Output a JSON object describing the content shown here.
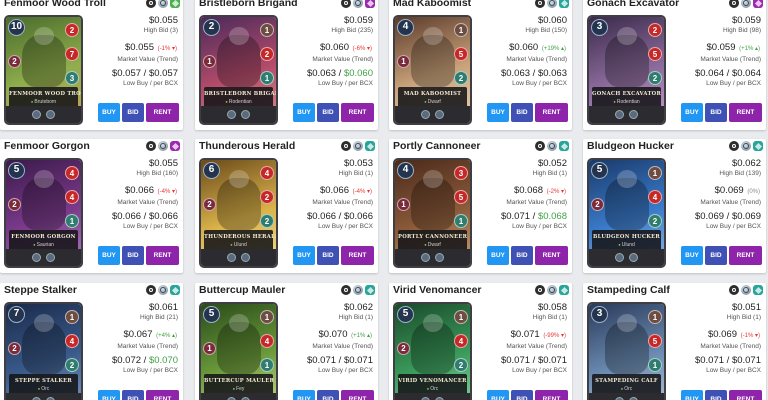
{
  "labels": {
    "high_bid": "High Bid",
    "market_value": "Market Value (Trend)",
    "low_buy": "Low Buy / per BCX",
    "buy": "BUY",
    "bid": "BID",
    "rent": "RENT",
    "separator": " / "
  },
  "cards": [
    {
      "name": "Fenmoor Wood Troll",
      "price": "$0.055",
      "bid_count": "(3)",
      "market": "$0.055",
      "change": "(-1% ▾)",
      "change_dir": "neg",
      "low_a": "$0.057",
      "low_b": "$0.057",
      "low_b_green": false,
      "mana": "10",
      "race": "Brutebom",
      "gem3": "gem-green",
      "stats": [
        "2",
        "7",
        "3"
      ],
      "left_stat": "2",
      "colors": [
        "#4a6b2c",
        "#8fae4c",
        "#c4a35a"
      ],
      "stat_colors": [
        "#c62828",
        "#c62828",
        "#2e7d6e"
      ]
    },
    {
      "name": "Bristleborn Brigand",
      "price": "$0.059",
      "bid_count": "(235)",
      "market": "$0.060",
      "change": "(-6% ▾)",
      "change_dir": "neg",
      "low_a": "$0.063",
      "low_b": "$0.060",
      "low_b_green": true,
      "mana": "2",
      "race": "Rodentian",
      "gem3": "gem-purple",
      "stats": [
        "1",
        "2",
        "1"
      ],
      "left_stat": "1",
      "colors": [
        "#4a2a5a",
        "#b34b6a",
        "#d98a8a"
      ],
      "stat_colors": [
        "#6d4c41",
        "#c62828",
        "#2e7d6e"
      ]
    },
    {
      "name": "Mad Kaboomist",
      "price": "$0.060",
      "bid_count": "(150)",
      "market": "$0.060",
      "change": "(+19% ▴)",
      "change_dir": "pos",
      "low_a": "$0.063",
      "low_b": "$0.063",
      "low_b_green": false,
      "mana": "4",
      "race": "Dwarf",
      "gem3": "gem-teal",
      "stats": [
        "1",
        "5",
        "2"
      ],
      "left_stat": "1",
      "colors": [
        "#5a3a2a",
        "#c9a27a",
        "#e8d3b0"
      ],
      "stat_colors": [
        "#6d4c41",
        "#c62828",
        "#2e7d6e"
      ]
    },
    {
      "name": "Gonach Excavator",
      "price": "$0.059",
      "bid_count": "(98)",
      "market": "$0.059",
      "change": "(+1% ▴)",
      "change_dir": "pos",
      "low_a": "$0.064",
      "low_b": "$0.064",
      "low_b_green": false,
      "mana": "3",
      "race": "Rodentian",
      "gem3": "gem-purple",
      "stats": [
        "2",
        "5",
        "2"
      ],
      "left_stat": "",
      "colors": [
        "#3a2a4a",
        "#8a6a9a",
        "#c59ad0"
      ],
      "stat_colors": [
        "#c62828",
        "#c62828",
        "#2e7d6e"
      ]
    },
    {
      "name": "Fenmoor Gorgon",
      "price": "$0.055",
      "bid_count": "(160)",
      "market": "$0.066",
      "change": "(-4% ▾)",
      "change_dir": "neg",
      "low_a": "$0.066",
      "low_b": "$0.066",
      "low_b_green": false,
      "mana": "5",
      "race": "Saurian",
      "gem3": "gem-purple",
      "stats": [
        "4",
        "4",
        "1"
      ],
      "left_stat": "2",
      "colors": [
        "#3a1a4a",
        "#7a3a8a",
        "#b07ac0"
      ],
      "stat_colors": [
        "#c62828",
        "#c62828",
        "#2e7d6e"
      ]
    },
    {
      "name": "Thunderous Herald",
      "price": "$0.053",
      "bid_count": "(1)",
      "market": "$0.066",
      "change": "(-4% ▾)",
      "change_dir": "neg",
      "low_a": "$0.066",
      "low_b": "$0.066",
      "low_b_green": false,
      "mana": "6",
      "race": "Ulund",
      "gem3": "gem-teal",
      "stats": [
        "4",
        "2",
        "2"
      ],
      "left_stat": "2",
      "colors": [
        "#6a4a1a",
        "#d9b24a",
        "#f2dc8a"
      ],
      "stat_colors": [
        "#c62828",
        "#c62828",
        "#2e7d6e"
      ]
    },
    {
      "name": "Portly Cannoneer",
      "price": "$0.052",
      "bid_count": "(1)",
      "market": "$0.068",
      "change": "(-2% ▾)",
      "change_dir": "neg",
      "low_a": "$0.071",
      "low_b": "$0.068",
      "low_b_green": true,
      "mana": "4",
      "race": "Dwarf",
      "gem3": "gem-teal",
      "stats": [
        "3",
        "5",
        "1"
      ],
      "left_stat": "1",
      "colors": [
        "#4a2a1a",
        "#8a5a3a",
        "#c9a070"
      ],
      "stat_colors": [
        "#c62828",
        "#c62828",
        "#2e7d6e"
      ]
    },
    {
      "name": "Bludgeon Hucker",
      "price": "$0.062",
      "bid_count": "(139)",
      "market": "$0.069",
      "change": "(0%)",
      "change_dir": "neu",
      "low_a": "$0.069",
      "low_b": "$0.069",
      "low_b_green": false,
      "mana": "5",
      "race": "Ulund",
      "gem3": "gem-teal",
      "stats": [
        "1",
        "4",
        "2"
      ],
      "left_stat": "2",
      "colors": [
        "#1a3a6a",
        "#3a7ac9",
        "#8ab8e8"
      ],
      "stat_colors": [
        "#6d4c41",
        "#c62828",
        "#2e7d6e"
      ]
    },
    {
      "name": "Steppe Stalker",
      "price": "$0.061",
      "bid_count": "(21)",
      "market": "$0.067",
      "change": "(+4% ▴)",
      "change_dir": "pos",
      "low_a": "$0.072",
      "low_b": "$0.070",
      "low_b_green": true,
      "mana": "7",
      "race": "Orc",
      "gem3": "gem-teal",
      "stats": [
        "1",
        "4",
        "2"
      ],
      "left_stat": "2",
      "colors": [
        "#1a2a4a",
        "#3a5a8a",
        "#7a9ac0"
      ],
      "stat_colors": [
        "#6d4c41",
        "#c62828",
        "#2e7d6e"
      ]
    },
    {
      "name": "Buttercup Mauler",
      "price": "$0.062",
      "bid_count": "(1)",
      "market": "$0.070",
      "change": "(+1% ▴)",
      "change_dir": "pos",
      "low_a": "$0.071",
      "low_b": "$0.071",
      "low_b_green": false,
      "mana": "5",
      "race": "Fey",
      "gem3": "gem-teal",
      "stats": [
        "1",
        "4",
        "1"
      ],
      "left_stat": "1",
      "colors": [
        "#2a4a1a",
        "#6a9a3a",
        "#c9d98a"
      ],
      "stat_colors": [
        "#6d4c41",
        "#c62828",
        "#2e7d6e"
      ]
    },
    {
      "name": "Virid Venomancer",
      "price": "$0.058",
      "bid_count": "(1)",
      "market": "$0.071",
      "change": "(-99% ▾)",
      "change_dir": "neg",
      "low_a": "$0.071",
      "low_b": "$0.071",
      "low_b_green": false,
      "mana": "5",
      "race": "Orc",
      "gem3": "gem-teal",
      "stats": [
        "1",
        "4",
        "2"
      ],
      "left_stat": "2",
      "colors": [
        "#1a4a2a",
        "#3a9a5a",
        "#8ad9a0"
      ],
      "stat_colors": [
        "#6d4c41",
        "#c62828",
        "#2e7d6e"
      ]
    },
    {
      "name": "Stampeding Calf",
      "price": "$0.051",
      "bid_count": "(1)",
      "market": "$0.069",
      "change": "(-1% ▾)",
      "change_dir": "neg",
      "low_a": "$0.071",
      "low_b": "$0.071",
      "low_b_green": false,
      "mana": "3",
      "race": "Orc",
      "gem3": "gem-teal",
      "stats": [
        "1",
        "5",
        "1"
      ],
      "left_stat": "",
      "colors": [
        "#2a3a5a",
        "#6a8ab0",
        "#b0c4d9"
      ],
      "stat_colors": [
        "#6d4c41",
        "#c62828",
        "#2e7d6e"
      ]
    }
  ],
  "icon_names": [
    "gear-icon",
    "silver-coin-icon",
    "gem-icon"
  ],
  "gem_colors": {
    "gem-green": "#4caf50",
    "gem-purple": "#9c27b0",
    "gem-teal": "#26a69a"
  }
}
